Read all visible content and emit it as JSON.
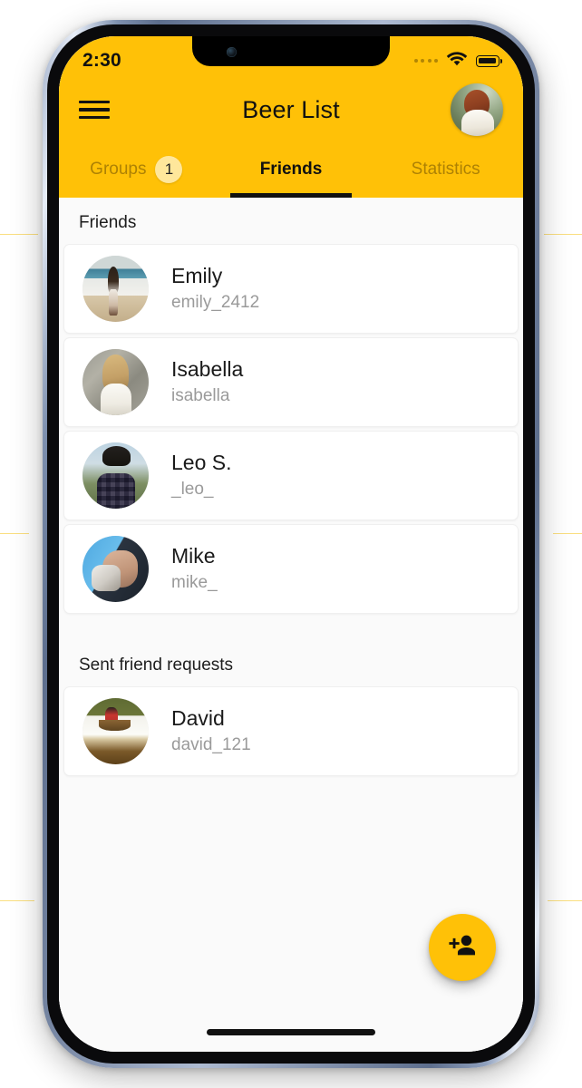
{
  "status_bar": {
    "time": "2:30",
    "signal_icon": "signal-dots-icon",
    "wifi_icon": "wifi-icon",
    "battery_icon": "battery-full-icon"
  },
  "header": {
    "menu_icon": "hamburger-menu-icon",
    "title": "Beer List",
    "avatar_icon": "user-avatar"
  },
  "tabs": [
    {
      "label": "Groups",
      "badge": "1",
      "active": false
    },
    {
      "label": "Friends",
      "badge": null,
      "active": true
    },
    {
      "label": "Statistics",
      "badge": null,
      "active": false
    }
  ],
  "sections": [
    {
      "title": "Friends",
      "items": [
        {
          "name": "Emily",
          "handle": "emily_2412",
          "avatar": "ph-emily"
        },
        {
          "name": "Isabella",
          "handle": "isabella",
          "avatar": "ph-isabella"
        },
        {
          "name": "Leo S.",
          "handle": "_leo_",
          "avatar": "ph-leo"
        },
        {
          "name": "Mike",
          "handle": "mike_",
          "avatar": "ph-mike"
        }
      ]
    },
    {
      "title": "Sent friend requests",
      "items": [
        {
          "name": "David",
          "handle": "david_121",
          "avatar": "ph-david"
        }
      ]
    }
  ],
  "fab": {
    "icon": "person-add-icon",
    "label": "Add friend"
  },
  "colors": {
    "accent": "#FFC107",
    "badge": "#FFE79B",
    "text_primary": "#1a1a1a",
    "text_secondary": "#9a9a9a",
    "surface": "#ffffff",
    "background": "#fafafa"
  }
}
